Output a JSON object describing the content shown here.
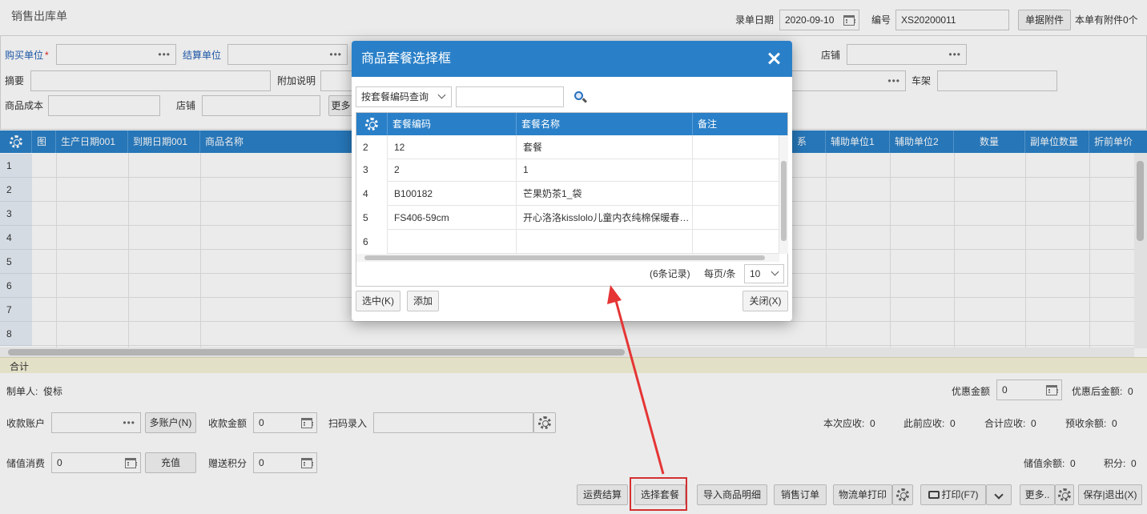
{
  "page": {
    "title": "销售出库单",
    "entry_date_label": "录单日期",
    "entry_date_value": "2020-09-10",
    "number_label": "编号",
    "number_value": "XS20200011",
    "attachment_button": "单据附件",
    "attachment_info": "本单有附件0个"
  },
  "form": {
    "buyer_label": "购买单位",
    "buyer_required": "*",
    "settle_label": "结算单位",
    "store_label": "店铺",
    "summary_label": "摘要",
    "extra_label": "附加说明",
    "frame_label": "车架",
    "cost_label": "商品成本",
    "store2_label": "店铺",
    "more_label": "更多",
    "dots": "•••"
  },
  "grid": {
    "columns": [
      "图",
      "生产日期001",
      "到期日期001",
      "商品名称",
      "系",
      "辅助单位1",
      "辅助单位2",
      "数量",
      "副单位数量",
      "折前单价"
    ],
    "rows": [
      "1",
      "2",
      "3",
      "4",
      "5",
      "6",
      "7",
      "8"
    ],
    "total_label": "合计"
  },
  "footer": {
    "maker_label": "制单人:",
    "maker_value": "俊标",
    "discount_label": "优惠金额",
    "discount_value": "0",
    "after_discount_label": "优惠后金额:",
    "after_discount_value": "0",
    "account_label": "收款账户",
    "multi_account_button": "多账户(N)",
    "receive_amount_label": "收款金额",
    "receive_amount_value": "0",
    "scan_label": "扫码录入",
    "this_receivable_label": "本次应收:",
    "this_receivable_value": "0",
    "prev_receivable_label": "此前应收:",
    "prev_receivable_value": "0",
    "total_receivable_label": "合计应收:",
    "total_receivable_value": "0",
    "prepaid_label": "预收余额:",
    "prepaid_value": "0",
    "stored_consume_label": "储值消费",
    "stored_consume_value": "0",
    "recharge_button": "充值",
    "gift_points_label": "赠送积分",
    "gift_points_value": "0",
    "stored_balance_label": "储值余额:",
    "stored_balance_value": "0",
    "points_label": "积分:",
    "points_value": "0"
  },
  "actions": {
    "freight": "运费结算",
    "select_package": "选择套餐",
    "import_detail": "导入商品明细",
    "sales_order": "销售订单",
    "logistics_print": "物流单打印",
    "print": "打印(F7)",
    "more": "更多..",
    "save_exit": "保存|退出(X)"
  },
  "modal": {
    "title": "商品套餐选择框",
    "query_mode": "按套餐编码查询",
    "search_value": "",
    "columns": [
      "套餐编码",
      "套餐名称",
      "备注"
    ],
    "rows": [
      {
        "num": "2",
        "code": "12",
        "name": "套餐",
        "note": ""
      },
      {
        "num": "3",
        "code": "2",
        "name": "1",
        "note": ""
      },
      {
        "num": "4",
        "code": "B100182",
        "name": "芒果奶茶1_袋",
        "note": ""
      },
      {
        "num": "5",
        "code": "FS406-59cm",
        "name": "开心洛洛kisslolo儿童内衣纯棉保暖春…",
        "note": ""
      },
      {
        "num": "6",
        "code": "",
        "name": "",
        "note": ""
      }
    ],
    "record_count": "(6条记录)",
    "per_page_label": "每页/条",
    "per_page_value": "10",
    "select_button": "选中(K)",
    "add_button": "添加",
    "close_button": "关闭(X)"
  },
  "colors": {
    "header_blue": "#2a80c8",
    "annotation_red": "#e53535",
    "label_blue": "#1f5fb3"
  }
}
